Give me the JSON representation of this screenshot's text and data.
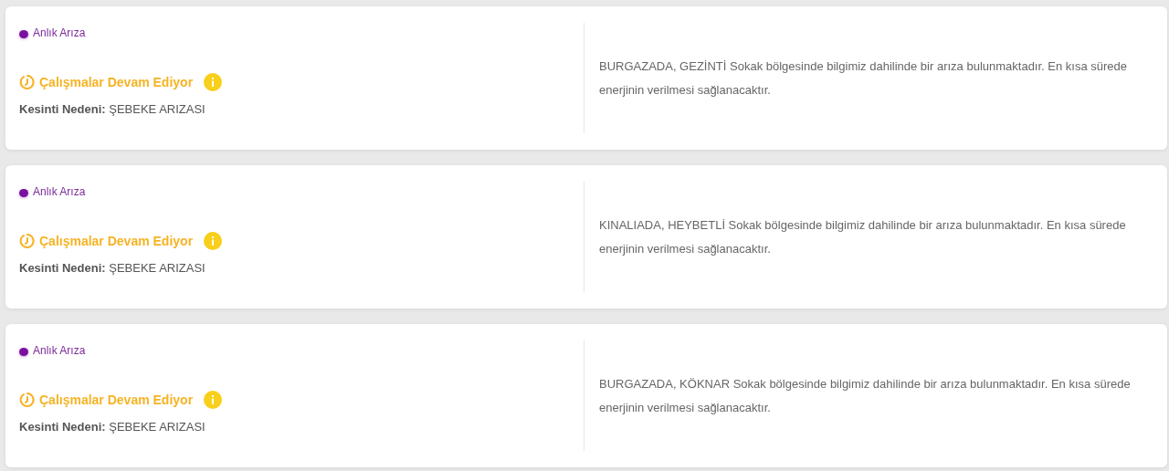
{
  "outages": [
    {
      "tag": {
        "label": "Anlık Arıza",
        "color": "#7b0fa0"
      },
      "status": "Çalışmalar Devam Ediyor",
      "cause_label": "Kesinti Nedeni:",
      "cause": "ŞEBEKE ARIZASI",
      "description": "BURGAZADA, GEZİNTİ Sokak bölgesinde bilgimiz dahilinde bir arıza bulunmaktadır. En kısa sürede enerjinin verilmesi sağlanacaktır."
    },
    {
      "tag": {
        "label": "Anlık Arıza",
        "color": "#7b0fa0"
      },
      "status": "Çalışmalar Devam Ediyor",
      "cause_label": "Kesinti Nedeni:",
      "cause": "ŞEBEKE ARIZASI",
      "description": "KINALIADA, HEYBETLİ Sokak bölgesinde bilgimiz dahilinde bir arıza bulunmaktadır. En kısa sürede enerjinin verilmesi sağlanacaktır."
    },
    {
      "tag": {
        "label": "Anlık Arıza",
        "color": "#7b0fa0"
      },
      "status": "Çalışmalar Devam Ediyor",
      "cause_label": "Kesinti Nedeni:",
      "cause": "ŞEBEKE ARIZASI",
      "description": "BURGAZADA, KÖKNAR Sokak bölgesinde bilgimiz dahilinde bir arıza bulunmaktadır. En kısa sürede enerjinin verilmesi sağlanacaktır."
    }
  ]
}
